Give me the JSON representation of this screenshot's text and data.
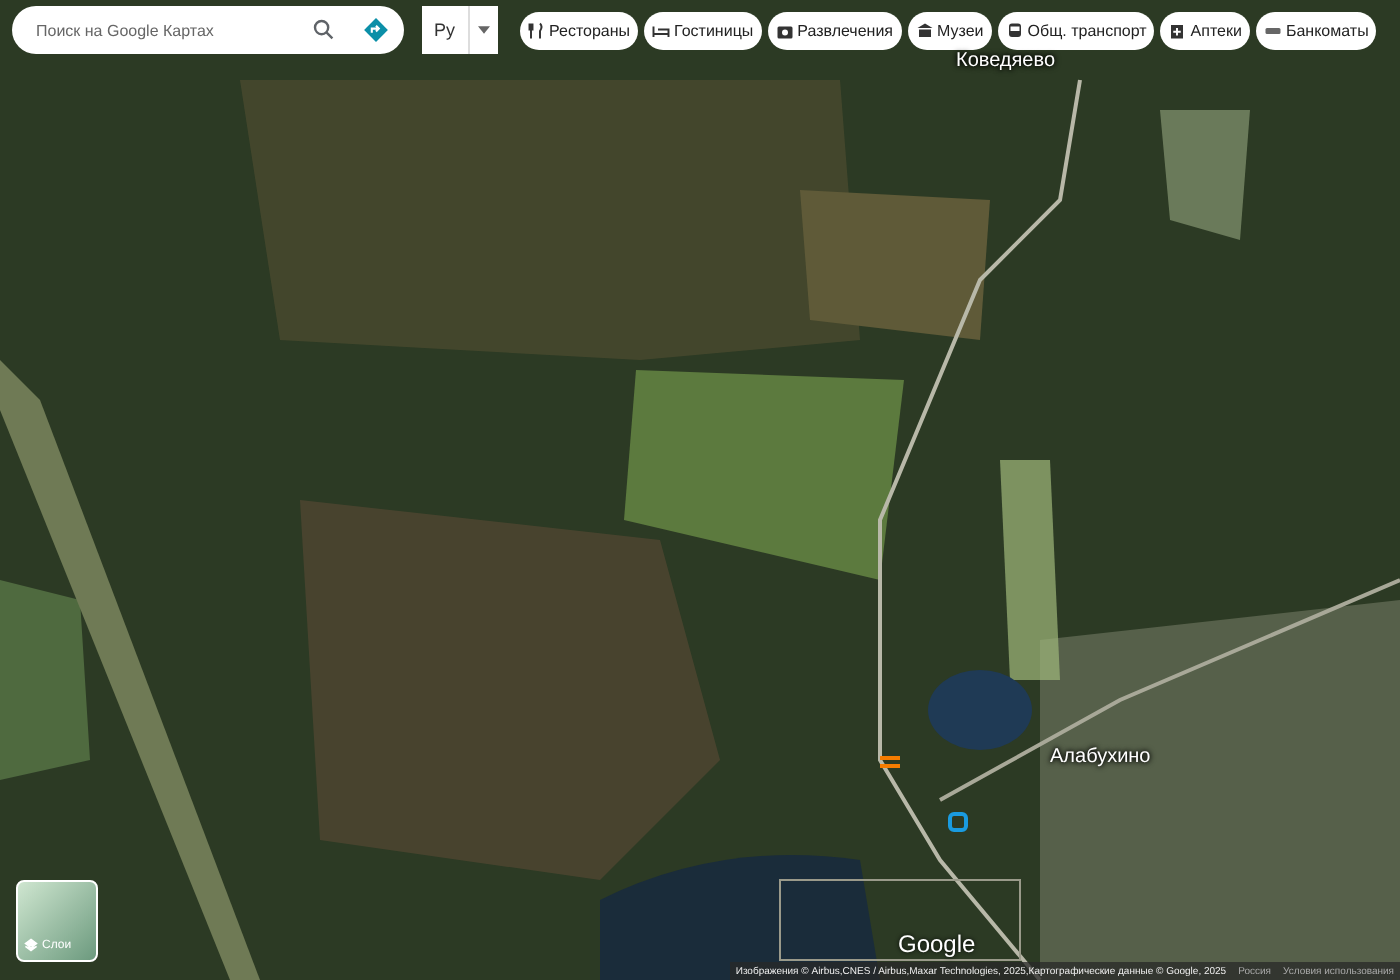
{
  "search": {
    "placeholder": "Поиск на Google Картах"
  },
  "language": {
    "label": "Ру"
  },
  "chips": [
    {
      "label": "Рестораны",
      "kind": "restaurant"
    },
    {
      "label": "Гостиницы",
      "kind": "hotel"
    },
    {
      "label": "Развлечения",
      "kind": "camera"
    },
    {
      "label": "Музеи",
      "kind": "museum"
    },
    {
      "label": "Общ. транспорт",
      "kind": "transit"
    },
    {
      "label": "Аптеки",
      "kind": "pharmacy"
    },
    {
      "label": "Банкоматы",
      "kind": "atm"
    }
  ],
  "map": {
    "places": [
      {
        "name": "Коведяево"
      },
      {
        "name": "Алабухино"
      }
    ]
  },
  "layers": {
    "label": "Слои"
  },
  "logo": "Google",
  "footer": {
    "attribution": "Изображения © Airbus,CNES / Airbus,Maxar Technologies, 2025,Картографические данные © Google, 2025",
    "country": "Россия",
    "terms": "Условия использования"
  }
}
